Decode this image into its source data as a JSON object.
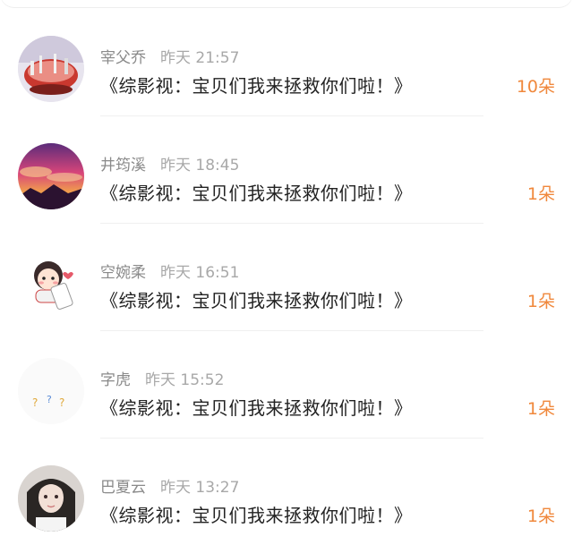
{
  "rows": [
    {
      "name": "宰父乔",
      "time": "昨天 21:57",
      "title": "《综影视：宝贝们我来拯救你们啦！》",
      "count": "10朵",
      "avatar": "avatar-food-bowl-icon"
    },
    {
      "name": "井筠溪",
      "time": "昨天 18:45",
      "title": "《综影视：宝贝们我来拯救你们啦！》",
      "count": "1朵",
      "avatar": "avatar-sunset-icon"
    },
    {
      "name": "空婉柔",
      "time": "昨天 16:51",
      "title": "《综影视：宝贝们我来拯救你们啦！》",
      "count": "1朵",
      "avatar": "avatar-cartoon-girl-icon"
    },
    {
      "name": "字虎",
      "time": "昨天 15:52",
      "title": "《综影视：宝贝们我来拯救你们啦！》",
      "count": "1朵",
      "avatar": "avatar-question-marks-icon"
    },
    {
      "name": "巴夏云",
      "time": "昨天 13:27",
      "title": "《综影视：宝贝们我来拯救你们啦！》",
      "count": "1朵",
      "avatar": "avatar-girl-photo-icon"
    }
  ],
  "colors": {
    "accent": "#f0883c",
    "name": "#8a8a8a",
    "title": "#222222"
  }
}
